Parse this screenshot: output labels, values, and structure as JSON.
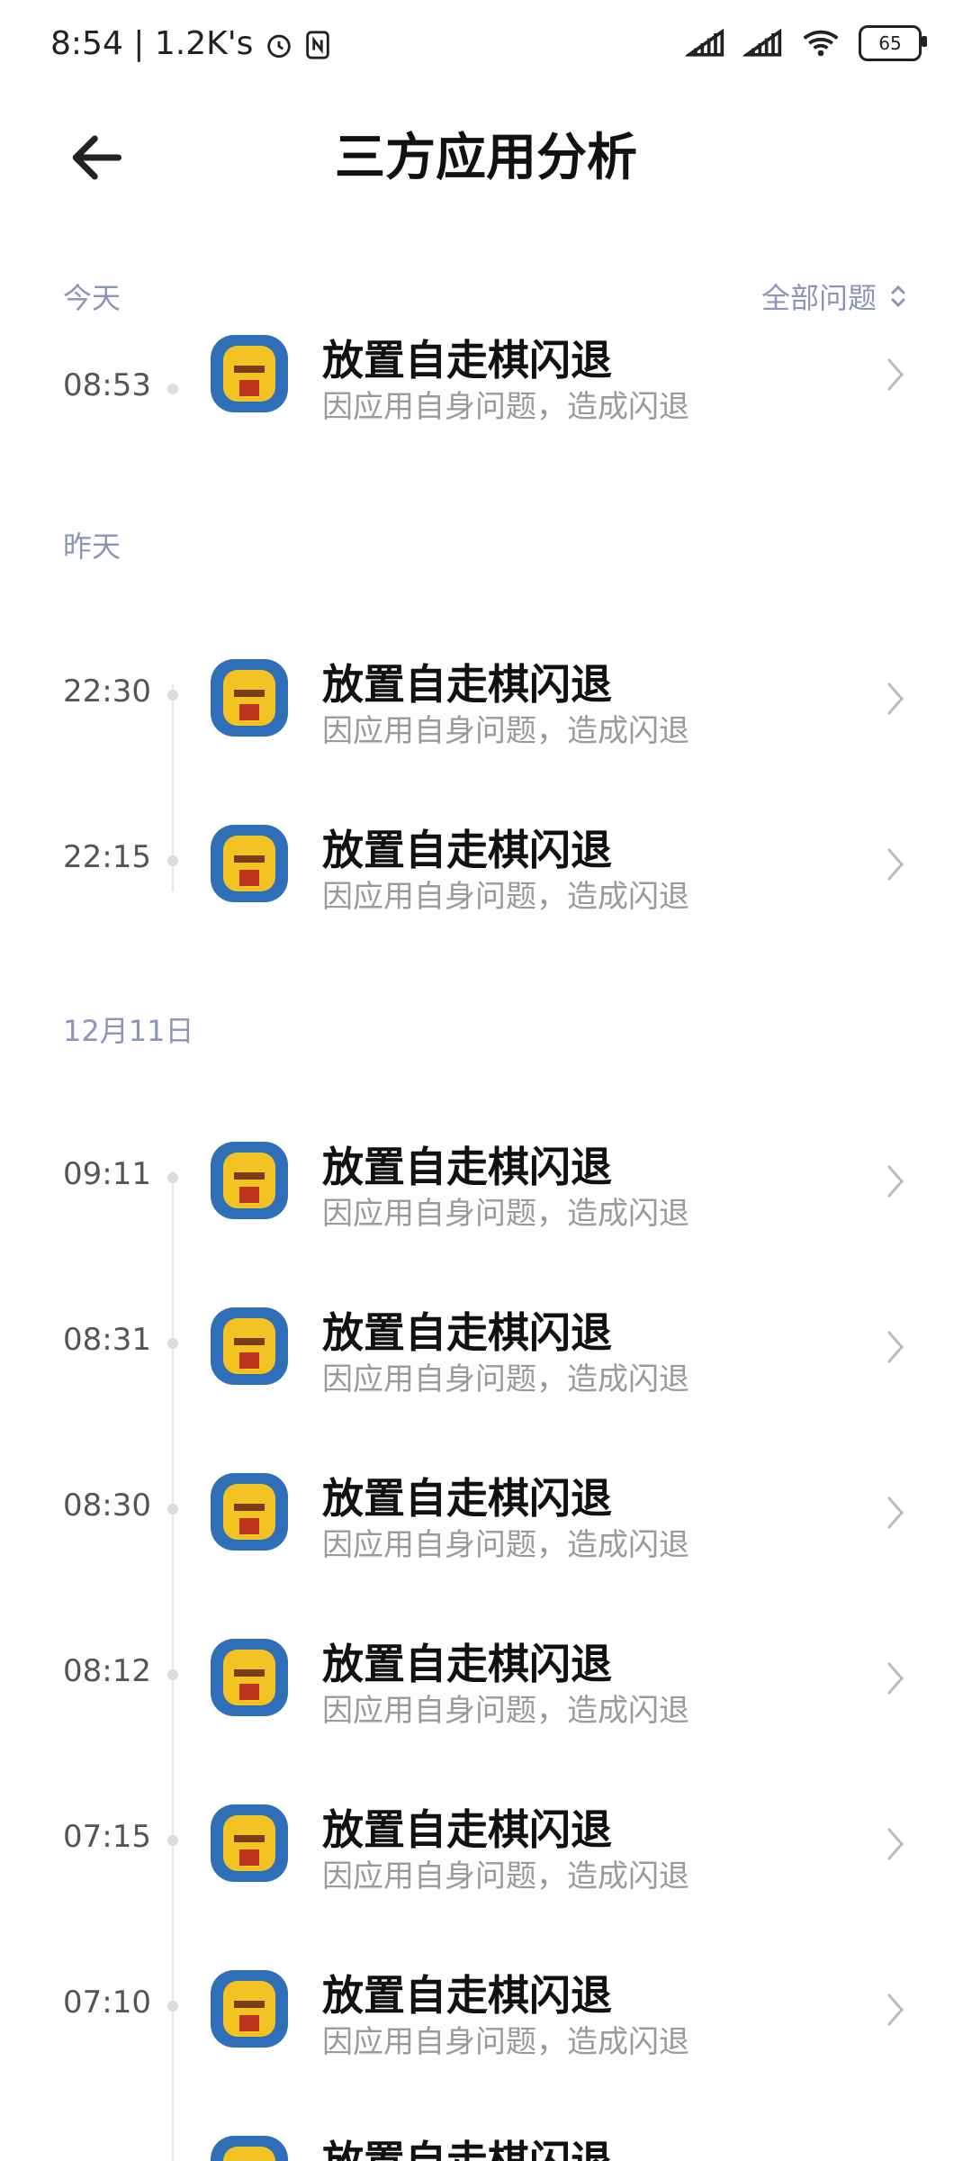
{
  "status": {
    "time": "8:54",
    "speed": "| 1.2K's"
  },
  "header": {
    "title": "三方应用分析"
  },
  "filter": {
    "label": "全部问题"
  },
  "sections": [
    {
      "label": "今天"
    },
    {
      "label": "昨天"
    },
    {
      "label": "12月11日"
    }
  ],
  "rows": [
    {
      "time": "08:53",
      "title": "放置自走棋闪退",
      "subtitle": "因应用自身问题，造成闪退"
    },
    {
      "time": "22:30",
      "title": "放置自走棋闪退",
      "subtitle": "因应用自身问题，造成闪退"
    },
    {
      "time": "22:15",
      "title": "放置自走棋闪退",
      "subtitle": "因应用自身问题，造成闪退"
    },
    {
      "time": "09:11",
      "title": "放置自走棋闪退",
      "subtitle": "因应用自身问题，造成闪退"
    },
    {
      "time": "08:31",
      "title": "放置自走棋闪退",
      "subtitle": "因应用自身问题，造成闪退"
    },
    {
      "time": "08:30",
      "title": "放置自走棋闪退",
      "subtitle": "因应用自身问题，造成闪退"
    },
    {
      "time": "08:12",
      "title": "放置自走棋闪退",
      "subtitle": "因应用自身问题，造成闪退"
    },
    {
      "time": "07:15",
      "title": "放置自走棋闪退",
      "subtitle": "因应用自身问题，造成闪退"
    },
    {
      "time": "07:10",
      "title": "放置自走棋闪退",
      "subtitle": "因应用自身问题，造成闪退"
    },
    {
      "time": "",
      "title": "放置自走棋闪退",
      "subtitle": ""
    }
  ],
  "icons": {
    "back": "back-arrow-icon",
    "chevron": "chevron-right-icon",
    "app": "app-icon"
  },
  "colors": {
    "section_text": "#8a95b8",
    "secondary_text": "#9a9a9a"
  }
}
